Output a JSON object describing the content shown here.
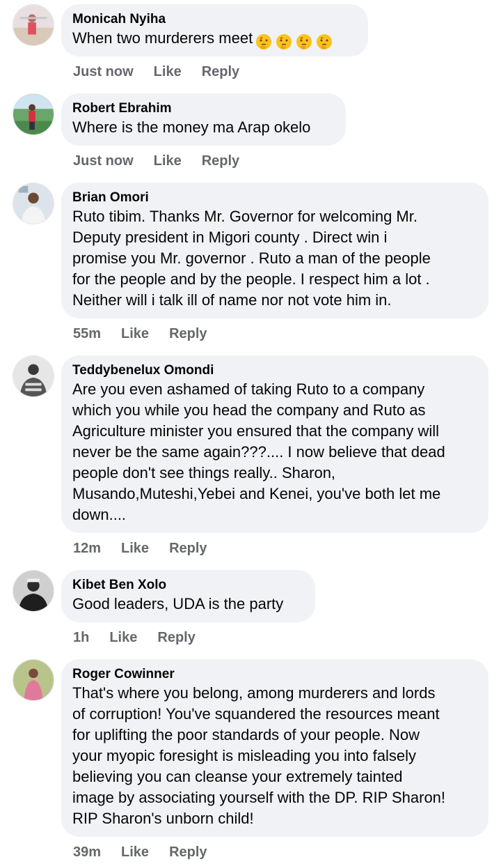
{
  "comments": [
    {
      "author": "Monicah Nyiha",
      "text": "When two murderers meet",
      "emoji": [
        "thinking-face-icon",
        "thinking-face-icon",
        "thinking-face-icon",
        "thinking-face-icon"
      ],
      "time": "Just now",
      "like": "Like",
      "reply": "Reply"
    },
    {
      "author": "Robert Ebrahim",
      "text": "Where is the money ma Arap okelo",
      "time": "Just now",
      "like": "Like",
      "reply": "Reply"
    },
    {
      "author": "Brian Omori",
      "text": "Ruto tibim. Thanks Mr. Governor for welcoming Mr.\nDeputy president in Migori county . Direct win i\npromise you Mr. governor . Ruto a man of the people\nfor the people and by the people. I respect him a lot .\nNeither will i talk ill of name nor not vote him in.",
      "time": "55m",
      "like": "Like",
      "reply": "Reply"
    },
    {
      "author": "Teddybenelux Omondi",
      "text": "Are you even ashamed of taking Ruto to a company\nwhich you while you head the company and Ruto as\nAgriculture minister you ensured that the company will\nnever be the same again???.... I now believe that dead\npeople don't see things really..  Sharon,\nMusando,Muteshi,Yebei and Kenei, you've both let me\ndown....",
      "time": "12m",
      "like": "Like",
      "reply": "Reply"
    },
    {
      "author": "Kibet Ben Xolo",
      "text": "Good leaders, UDA is the party",
      "time": "1h",
      "like": "Like",
      "reply": "Reply"
    },
    {
      "author": "Roger Cowinner",
      "text": "That's where you belong, among murderers and lords\nof corruption! You've squandered the resources meant\nfor uplifting the poor standards of your people. Now\nyour myopic foresight is misleading you into falsely\nbelieving you can cleanse your extremely tainted\nimage by associating yourself with the DP. RIP Sharon!\nRIP Sharon's unborn child!",
      "time": "39m",
      "like": "Like",
      "reply": "Reply"
    }
  ],
  "colors": {
    "bubble": "#f0f2f5",
    "meta": "#65676b",
    "text": "#050505"
  }
}
